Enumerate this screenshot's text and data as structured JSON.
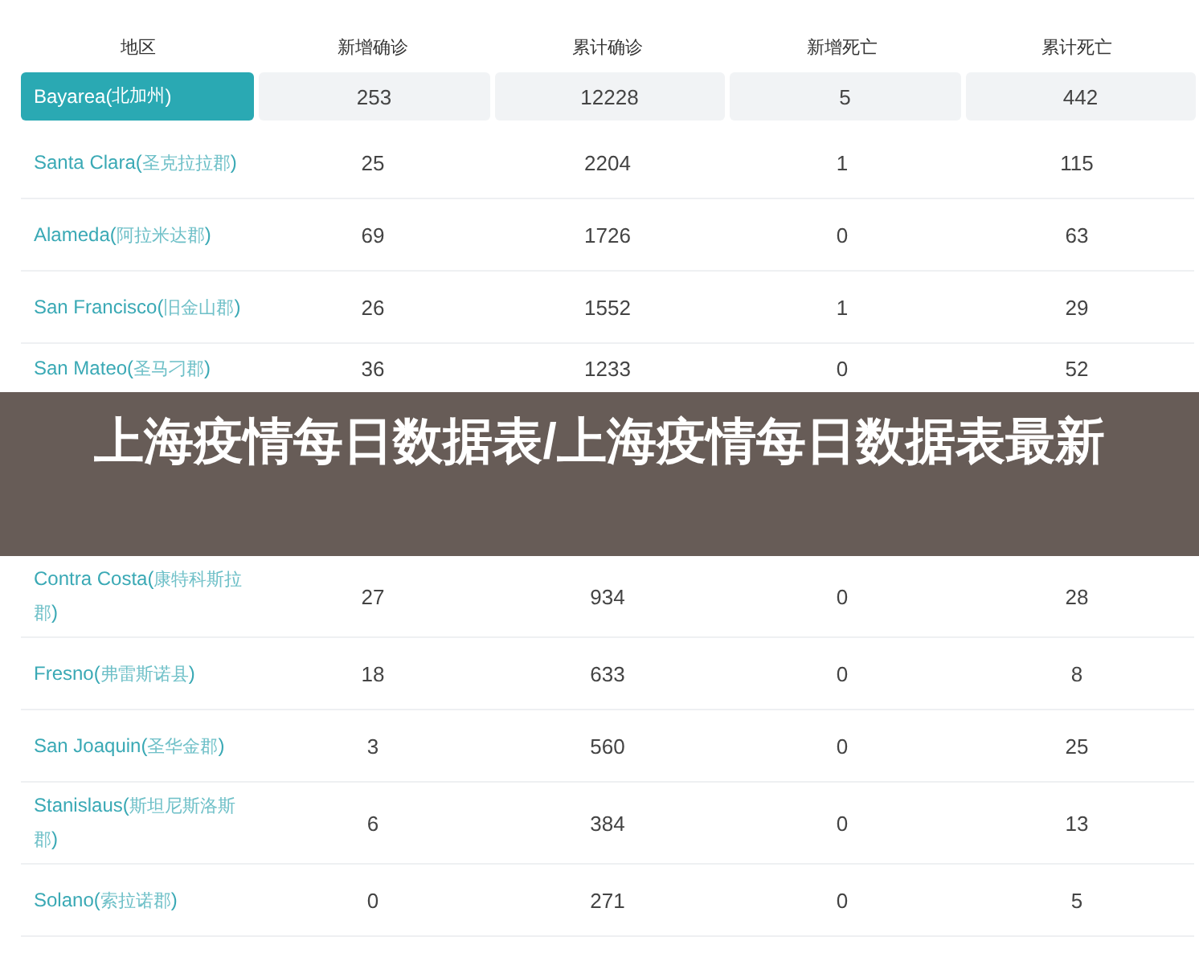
{
  "table": {
    "columns": [
      "地区",
      "新增确诊",
      "累计确诊",
      "新增死亡",
      "累计死亡"
    ],
    "rows": [
      {
        "region": [
          "Bayarea(",
          "北加州",
          ")"
        ],
        "values": [
          "253",
          "12228",
          "5",
          "442"
        ],
        "selected": true
      },
      {
        "region": [
          "Santa Clara(",
          "圣克拉拉郡",
          ")"
        ],
        "values": [
          "25",
          "2204",
          "1",
          "115"
        ],
        "selected": false
      },
      {
        "region": [
          "Alameda(",
          "阿拉米达郡",
          ")"
        ],
        "values": [
          "69",
          "1726",
          "0",
          "63"
        ],
        "selected": false
      },
      {
        "region": [
          "San Francisco(",
          "旧金山郡",
          ")"
        ],
        "values": [
          "26",
          "1552",
          "1",
          "29"
        ],
        "selected": false
      },
      {
        "region": [
          "San Mateo(",
          "圣马刁郡",
          ")"
        ],
        "values": [
          "36",
          "1233",
          "0",
          "52"
        ],
        "selected": false
      },
      {
        "region": [
          "Contra Costa(",
          "康特科斯拉郡",
          ")"
        ],
        "values": [
          "27",
          "934",
          "0",
          "28"
        ],
        "selected": false
      },
      {
        "region": [
          "Fresno(",
          "弗雷斯诺县",
          ")"
        ],
        "values": [
          "18",
          "633",
          "0",
          "8"
        ],
        "selected": false
      },
      {
        "region": [
          "San Joaquin(",
          "圣华金郡",
          ")"
        ],
        "values": [
          "3",
          "560",
          "0",
          "25"
        ],
        "selected": false
      },
      {
        "region": [
          "Stanislaus(",
          "斯坦尼斯洛斯郡",
          ")"
        ],
        "values": [
          "6",
          "384",
          "0",
          "13"
        ],
        "selected": false
      },
      {
        "region": [
          "Solano(",
          "索拉诺郡",
          ")"
        ],
        "values": [
          "0",
          "271",
          "0",
          "5"
        ],
        "selected": false
      }
    ]
  },
  "banner": {
    "title": "上海疫情每日数据表/上海疫情每日数据表最新"
  }
}
